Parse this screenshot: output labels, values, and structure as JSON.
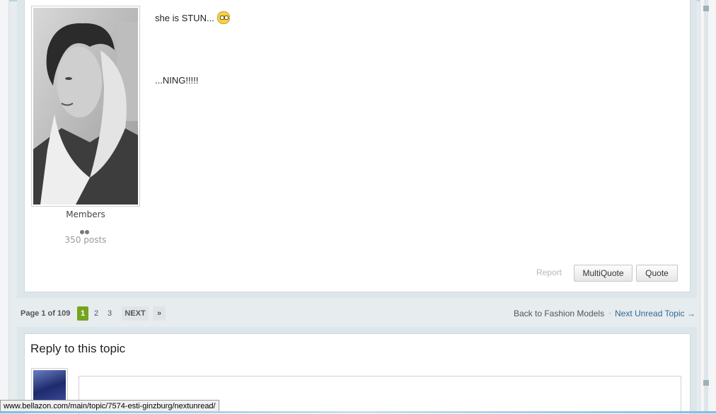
{
  "post": {
    "member_group": "Members",
    "post_count": "350 posts",
    "line1": "she is STUN...",
    "line2": "...NING!!!!!",
    "report_label": "Report",
    "multiquote_label": "MultiQuote",
    "quote_label": "Quote"
  },
  "pagination": {
    "page_label": "Page 1 of 109",
    "pages": [
      "1",
      "2",
      "3"
    ],
    "current_page": "1",
    "next_label": "NEXT",
    "last_label": "»",
    "back_link": "Back to Fashion Models",
    "separator": "·",
    "next_unread": "Next Unread Topic →"
  },
  "reply": {
    "title": "Reply to this topic"
  },
  "status_bar": {
    "url": "www.bellazon.com/main/topic/7574-esti-ginzburg/nextunread/"
  },
  "colors": {
    "active_page": "#75a41e",
    "link": "#2f6a92",
    "page_bg": "#e7ecee"
  }
}
